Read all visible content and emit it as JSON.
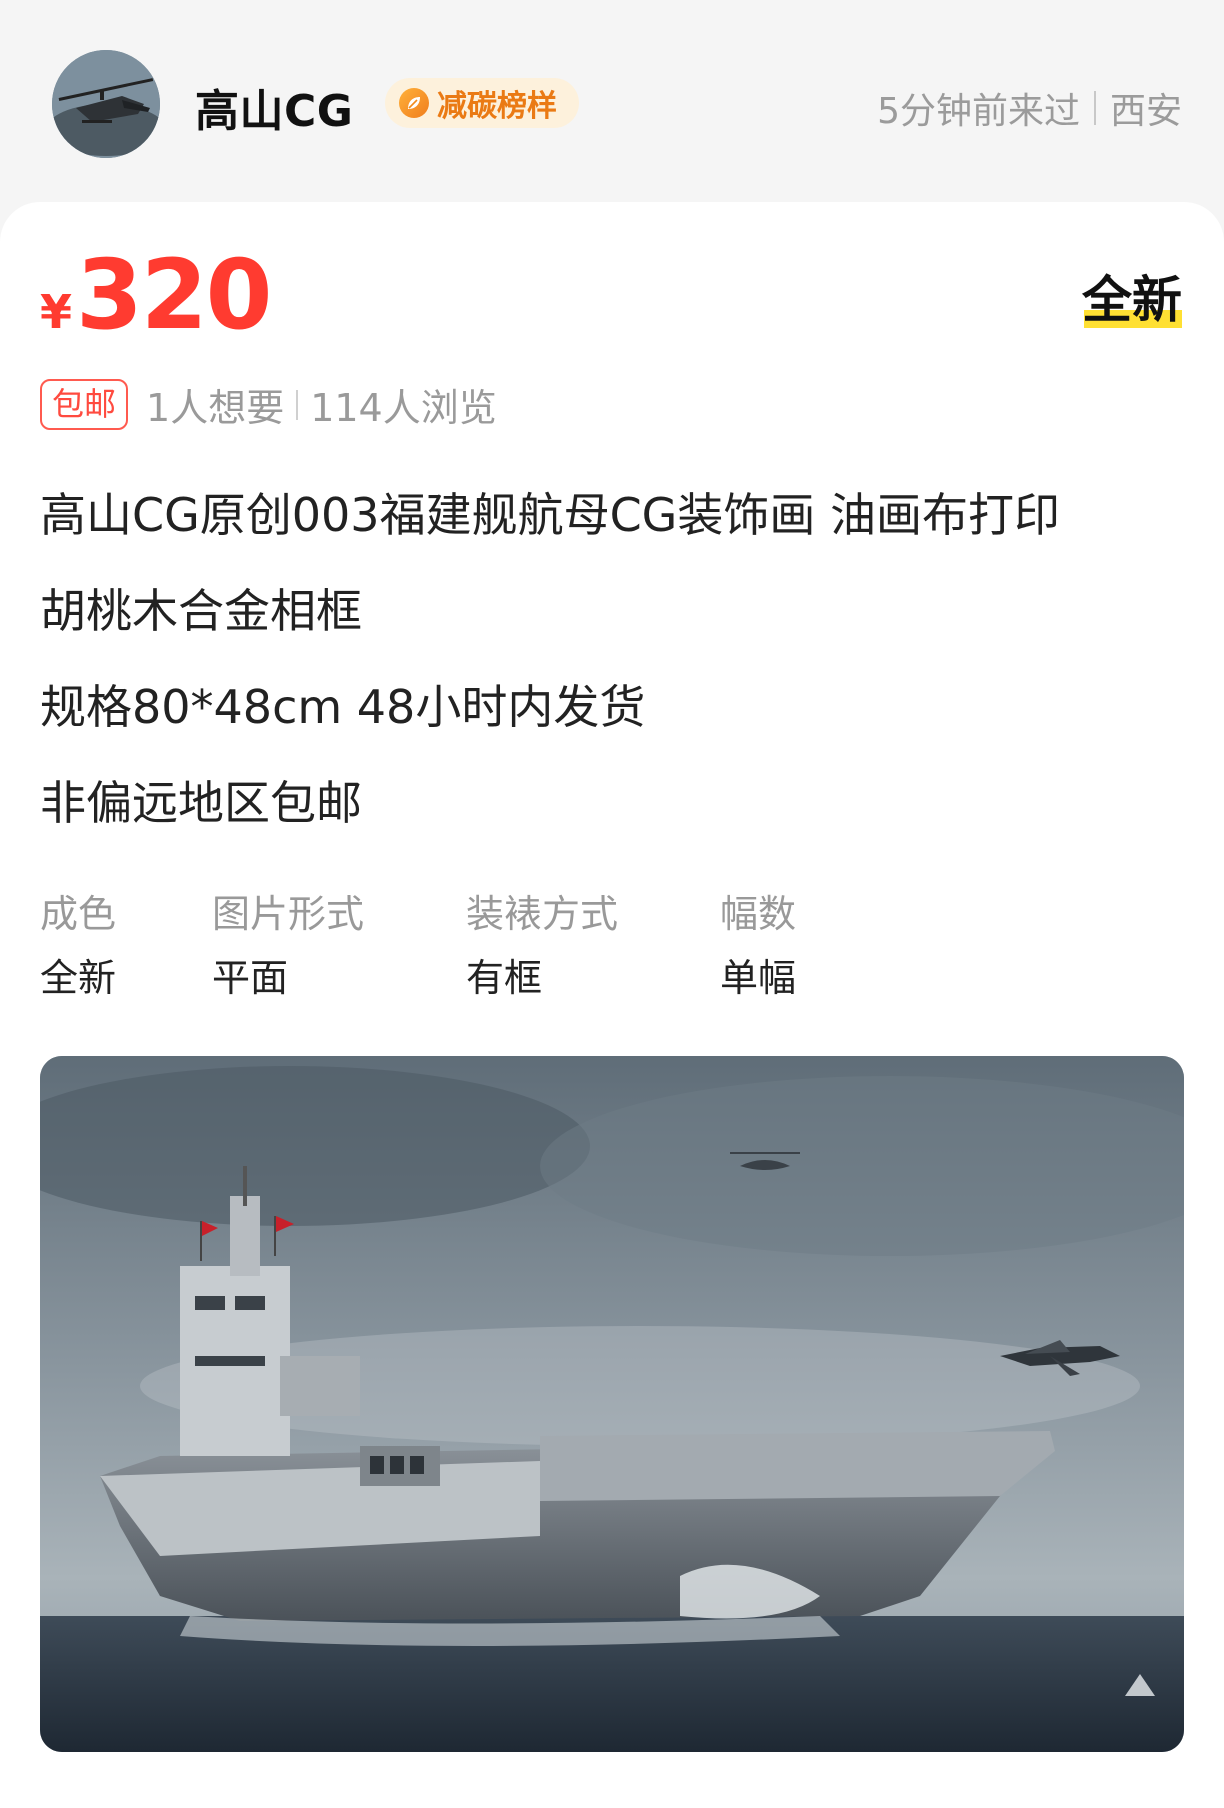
{
  "seller": {
    "name": "高山CG",
    "badge_label": "减碳榜样",
    "last_seen": "5分钟前来过",
    "location": "西安"
  },
  "listing": {
    "price_symbol": "¥",
    "price": "320",
    "condition_tag": "全新",
    "shipping_tag": "包邮",
    "wants": "1人想要",
    "views": "114人浏览",
    "description_lines": [
      "高山CG原创003福建舰航母CG装饰画 油画布打印",
      "胡桃木合金相框",
      "规格80*48cm  48小时内发货",
      "非偏远地区包邮"
    ],
    "attributes": [
      {
        "key": "成色",
        "value": "全新"
      },
      {
        "key": "图片形式",
        "value": "平面"
      },
      {
        "key": "装裱方式",
        "value": "有框"
      },
      {
        "key": "幅数",
        "value": "单幅"
      }
    ]
  },
  "colors": {
    "price": "#ff3b30",
    "badge_bg": "#fdf1dc",
    "badge_text": "#ea7a14",
    "highlight": "#ffe033"
  },
  "icons": {
    "badge": "leaf-icon",
    "avatar": "helicopter-avatar"
  }
}
